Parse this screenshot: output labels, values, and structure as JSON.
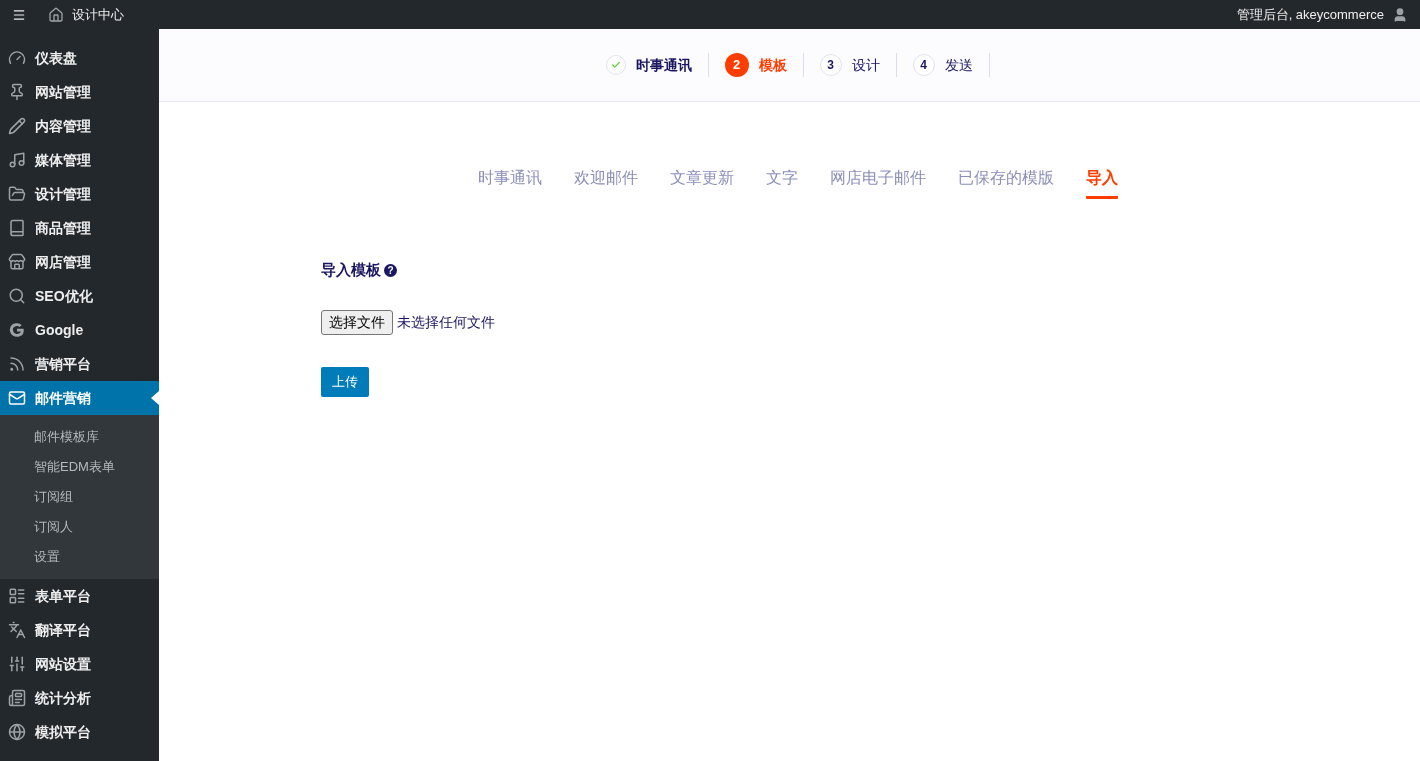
{
  "topbar": {
    "title": "设计中心",
    "account": "管理后台, akeycommerce"
  },
  "sidebar": {
    "items": [
      {
        "label": "仪表盘",
        "selected": false
      },
      {
        "label": "网站管理",
        "selected": false
      },
      {
        "label": "内容管理",
        "selected": false
      },
      {
        "label": "媒体管理",
        "selected": false
      },
      {
        "label": "设计管理",
        "selected": false
      },
      {
        "label": "商品管理",
        "selected": false
      },
      {
        "label": "网店管理",
        "selected": false
      },
      {
        "label": "SEO优化",
        "selected": false
      },
      {
        "label": "Google",
        "selected": false
      },
      {
        "label": "营销平台",
        "selected": false
      },
      {
        "label": "邮件营销",
        "selected": true,
        "children": [
          {
            "label": "邮件模板库"
          },
          {
            "label": "智能EDM表单"
          },
          {
            "label": "订阅组"
          },
          {
            "label": "订阅人"
          },
          {
            "label": "设置"
          }
        ]
      },
      {
        "label": "表单平台",
        "selected": false
      },
      {
        "label": "翻译平台",
        "selected": false
      },
      {
        "label": "网站设置",
        "selected": false
      },
      {
        "label": "统计分析",
        "selected": false
      },
      {
        "label": "模拟平台",
        "selected": false
      }
    ]
  },
  "steps": [
    {
      "kind": "done",
      "label": "时事通讯"
    },
    {
      "kind": "current",
      "number": "2",
      "label": "模板"
    },
    {
      "kind": "pending",
      "number": "3",
      "label": "设计"
    },
    {
      "kind": "pending",
      "number": "4",
      "label": "发送"
    }
  ],
  "tabs": [
    {
      "label": "时事通讯",
      "selected": false
    },
    {
      "label": "欢迎邮件",
      "selected": false
    },
    {
      "label": "文章更新",
      "selected": false
    },
    {
      "label": "文字",
      "selected": false
    },
    {
      "label": "网店电子邮件",
      "selected": false
    },
    {
      "label": "已保存的模版",
      "selected": false
    },
    {
      "label": "导入",
      "selected": true
    }
  ],
  "import": {
    "heading": "导入模板",
    "help_icon": "?",
    "choose_button": "选择文件",
    "file_status": "未选择任何文件",
    "upload_button": "上传"
  }
}
